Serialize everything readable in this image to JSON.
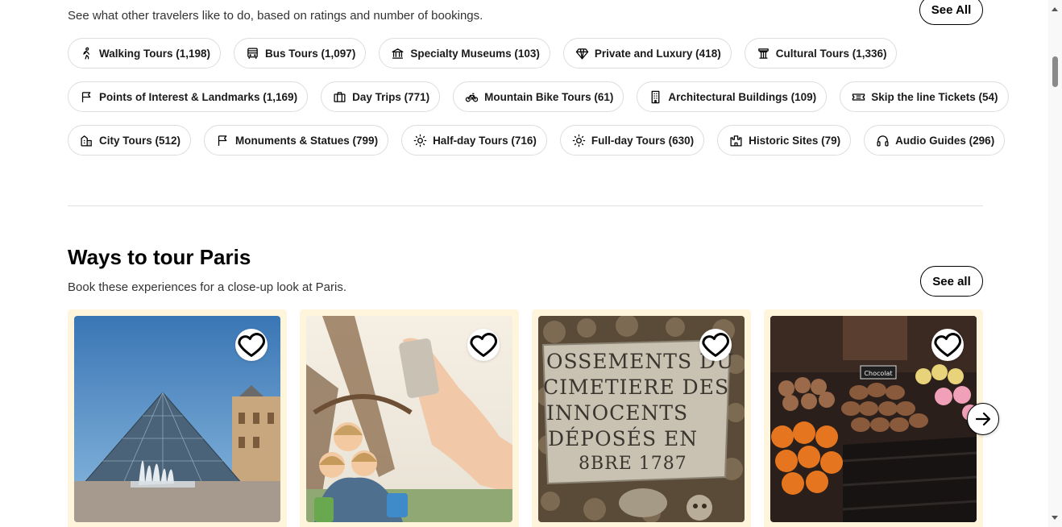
{
  "top_section": {
    "subtitle": "See what other travelers like to do, based on ratings and number of bookings.",
    "see_all_label": "See All"
  },
  "chip_rows": [
    [
      {
        "icon": "walking-icon",
        "label": "Walking Tours (1,198)"
      },
      {
        "icon": "bus-icon",
        "label": "Bus Tours (1,097)"
      },
      {
        "icon": "museum-icon",
        "label": "Specialty Museums (103)"
      },
      {
        "icon": "diamond-icon",
        "label": "Private and Luxury (418)"
      },
      {
        "icon": "column-icon",
        "label": "Cultural Tours (1,336)"
      }
    ],
    [
      {
        "icon": "flag-icon",
        "label": "Points of Interest & Landmarks (1,169)"
      },
      {
        "icon": "briefcase-icon",
        "label": "Day Trips (771)"
      },
      {
        "icon": "bicycle-icon",
        "label": "Mountain Bike Tours (61)"
      },
      {
        "icon": "building-icon",
        "label": "Architectural Buildings (109)"
      },
      {
        "icon": "ticket-icon",
        "label": "Skip the line Tickets (54)"
      }
    ],
    [
      {
        "icon": "city-icon",
        "label": "City Tours (512)"
      },
      {
        "icon": "flag-icon",
        "label": "Monuments & Statues (799)"
      },
      {
        "icon": "sun-icon",
        "label": "Half-day Tours (716)"
      },
      {
        "icon": "sun-icon",
        "label": "Full-day Tours (630)"
      },
      {
        "icon": "castle-icon",
        "label": "Historic Sites (79)"
      },
      {
        "icon": "headphones-icon",
        "label": "Audio Guides (296)"
      }
    ]
  ],
  "ways_section": {
    "title": "Ways to tour Paris",
    "subtitle": "Book these experiences for a close-up look at Paris.",
    "see_all_label": "See all",
    "cards": [
      {
        "image": "louvre-pyramid-photo"
      },
      {
        "image": "eiffel-tower-kids-photo"
      },
      {
        "image": "catacombs-sign-photo",
        "sign_lines": [
          "OSSEMENTS DU",
          "CIMETIERE DES",
          "INNOCENTS",
          "DÉPOSÉS EN",
          "8BRE 1787"
        ]
      },
      {
        "image": "macarons-market-photo",
        "sign_text": "Chocolat"
      }
    ]
  },
  "colors": {
    "card_background": "#fff5dc",
    "chip_border": "#dddddd",
    "divider": "#e0e0e0"
  }
}
